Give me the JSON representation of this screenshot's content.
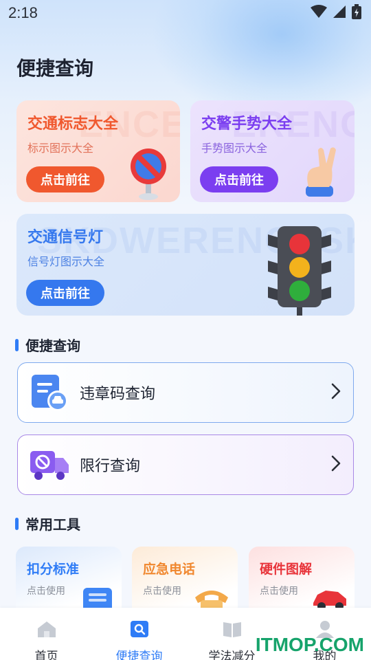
{
  "status_bar": {
    "time": "2:18"
  },
  "page": {
    "title": "便捷查询"
  },
  "feature_cards": [
    {
      "title": "交通标志大全",
      "subtitle": "标示图示大全",
      "button": "点击前往",
      "bg_word": "ENCE ERENCE",
      "accent": "#f0582e"
    },
    {
      "title": "交警手势大全",
      "subtitle": "手势图示大全",
      "button": "点击前往",
      "bg_word": "ERENCE ERENCE",
      "accent": "#7b3ef0"
    },
    {
      "title": "交通信号灯",
      "subtitle": "信号灯图示大全",
      "button": "点击前往",
      "bg_word": "SKDWERENCESKDWERD",
      "accent": "#3578ee"
    }
  ],
  "quick_query": {
    "heading": "便捷查询",
    "items": [
      {
        "label": "违章码查询",
        "icon": "ticket-car-icon"
      },
      {
        "label": "限行查询",
        "icon": "truck-restriction-icon"
      }
    ]
  },
  "tools": {
    "heading": "常用工具",
    "items": [
      {
        "title": "扣分标准",
        "subtitle": "点击使用",
        "color": "#2f7cf6",
        "icon": "document-stack-icon"
      },
      {
        "title": "应急电话",
        "subtitle": "点击使用",
        "color": "#f0872e",
        "icon": "telephone-icon"
      },
      {
        "title": "硬件图解",
        "subtitle": "点击使用",
        "color": "#e8343a",
        "icon": "car-toy-icon"
      }
    ]
  },
  "tab_bar": {
    "items": [
      {
        "label": "首页",
        "icon": "home-icon",
        "active": false
      },
      {
        "label": "便捷查询",
        "icon": "search-tab-icon",
        "active": true
      },
      {
        "label": "学法减分",
        "icon": "book-icon",
        "active": false
      },
      {
        "label": "我的",
        "icon": "user-icon",
        "active": false
      }
    ]
  },
  "watermark": {
    "text": "ITMOP.COM"
  },
  "colors": {
    "primary": "#2f7cf6",
    "background": "#f4f7fd"
  }
}
